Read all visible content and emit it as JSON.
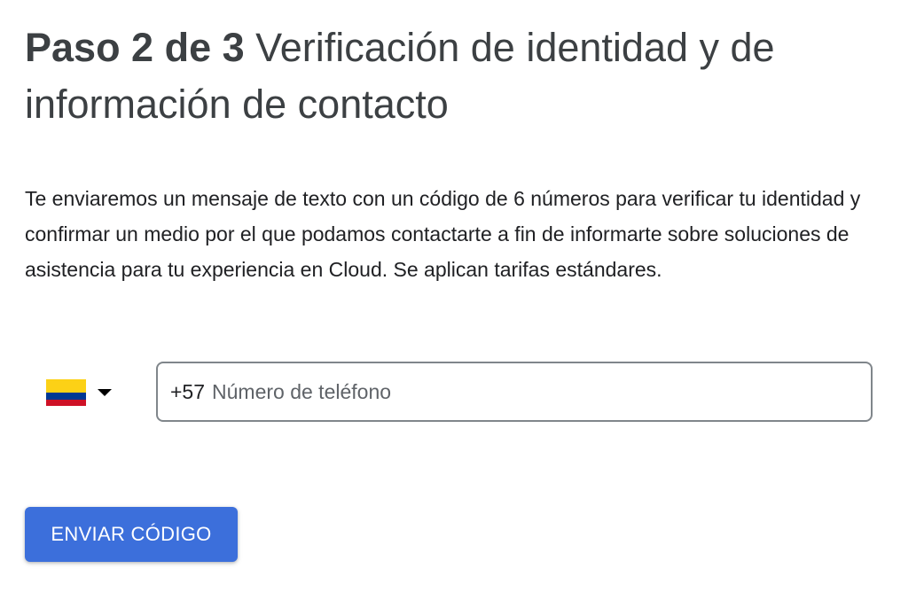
{
  "heading": {
    "step": "Paso 2 de 3",
    "title": "Verificación de identidad y de información de contacto"
  },
  "description": "Te enviaremos un mensaje de texto con un código de 6 números para verificar tu identidad y confirmar un medio por el que podamos contactarte a fin de informarte sobre soluciones de asistencia para tu experiencia en Cloud. Se aplican tarifas estándares.",
  "phone": {
    "country_flag": "colombia-flag",
    "dial_code": "+57",
    "placeholder": "Número de teléfono",
    "value": ""
  },
  "send_button": {
    "label": "ENVIAR CÓDIGO"
  },
  "colors": {
    "primary_button": "#3c6fdb",
    "field_border": "#80868b"
  }
}
